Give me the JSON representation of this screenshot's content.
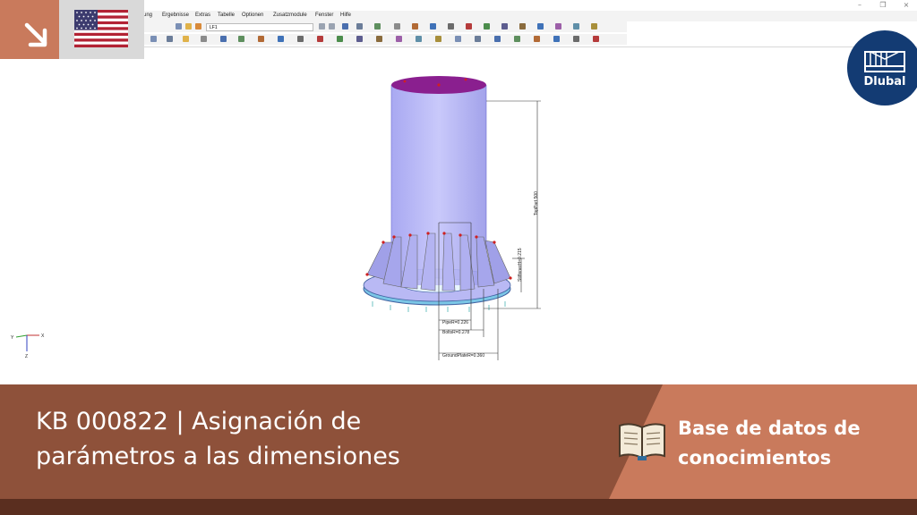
{
  "window": {
    "minimize": "–",
    "restore": "❐",
    "close": "×"
  },
  "menu": [
    "ung",
    "Ergebnisse",
    "Extras",
    "Tabelle",
    "Optionen",
    "Zusatzmodule",
    "Fenster",
    "Hilfe"
  ],
  "toolbar": {
    "load_case": "LF1"
  },
  "badge": {
    "arrow_icon": "arrow-down-right-icon",
    "flag_icon": "us-flag-icon"
  },
  "logo": {
    "text": "Dlubal"
  },
  "model": {
    "dimensions": {
      "top_part": "TopPart 500",
      "stiffener": "StiffenerH=0.215",
      "pipe": "PipeR=0.226",
      "bolts": "BoltsR=0.278",
      "ground_plate": "GroundPlateR=0.360"
    },
    "axes": {
      "x": "X",
      "y": "Y",
      "z": "Z"
    }
  },
  "footer": {
    "title_line1": "KB 000822 | Asignación de",
    "title_line2": "parámetros a las dimensiones",
    "category_line1": "Base de datos de",
    "category_line2": "conocimientos",
    "book_icon": "open-book-icon"
  },
  "colors": {
    "accent": "#c97a5c",
    "footer_bg": "#8e513a",
    "footer_dark": "#5a2e1f",
    "logo_bg": "#133b73",
    "pipe_fill": "#a9a9f0"
  }
}
